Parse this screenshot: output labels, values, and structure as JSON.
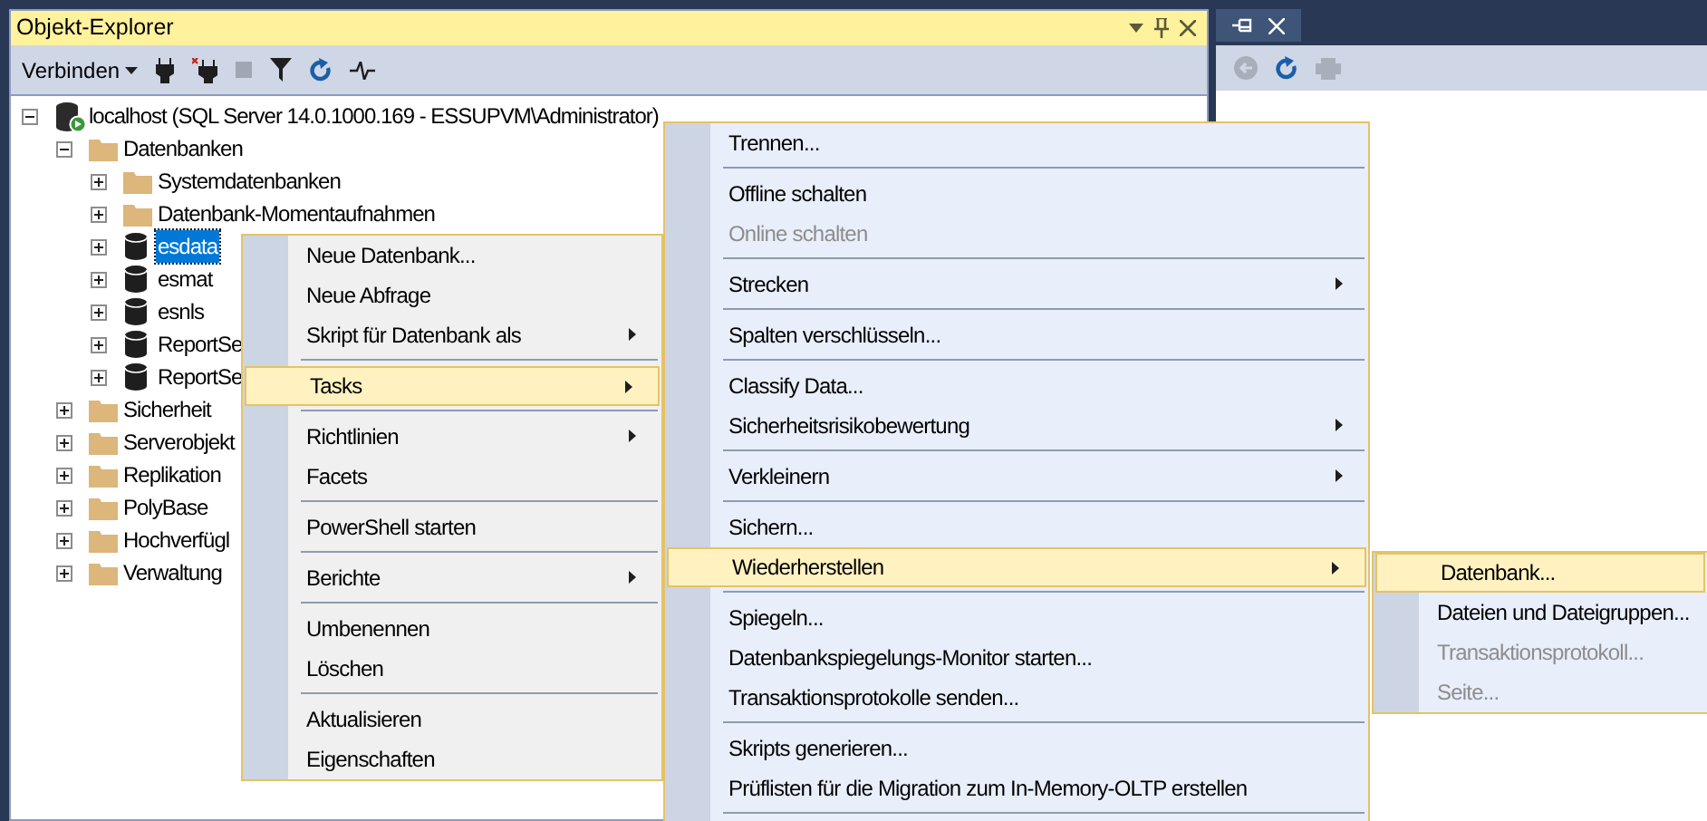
{
  "explorer": {
    "title": "Objekt-Explorer",
    "connect_label": "Verbinden",
    "tree": [
      {
        "kind": "server",
        "label": "localhost (SQL Server 14.0.1000.169 - ESSUPVM\\Administrator)",
        "expanded": true,
        "selected": false,
        "children": [
          {
            "kind": "folder",
            "label": "Datenbanken",
            "expanded": true,
            "selected": false,
            "children": [
              {
                "kind": "folder",
                "label": "Systemdatenbanken",
                "expanded": false,
                "selected": false
              },
              {
                "kind": "folder",
                "label": "Datenbank-Momentaufnahmen",
                "expanded": false,
                "selected": false
              },
              {
                "kind": "database",
                "label": "esdata",
                "expanded": false,
                "selected": true
              },
              {
                "kind": "database",
                "label": "esmat",
                "expanded": false,
                "selected": false
              },
              {
                "kind": "database",
                "label": "esnls",
                "expanded": false,
                "selected": false
              },
              {
                "kind": "database",
                "label": "ReportSe",
                "expanded": false,
                "selected": false
              },
              {
                "kind": "database",
                "label": "ReportSe",
                "expanded": false,
                "selected": false
              }
            ]
          },
          {
            "kind": "folder",
            "label": "Sicherheit",
            "expanded": false,
            "selected": false
          },
          {
            "kind": "folder",
            "label": "Serverobjekt",
            "expanded": false,
            "selected": false
          },
          {
            "kind": "folder",
            "label": "Replikation",
            "expanded": false,
            "selected": false
          },
          {
            "kind": "folder",
            "label": "PolyBase",
            "expanded": false,
            "selected": false
          },
          {
            "kind": "folder",
            "label": "Hochverfügl",
            "expanded": false,
            "selected": false
          },
          {
            "kind": "folder",
            "label": "Verwaltung",
            "expanded": false,
            "selected": false
          }
        ]
      }
    ]
  },
  "menus": [
    {
      "items": [
        {
          "kind": "item",
          "label": "Neue Datenbank...",
          "submenu": false,
          "disabled": false,
          "selected": false
        },
        {
          "kind": "item",
          "label": "Neue Abfrage",
          "submenu": false,
          "disabled": false,
          "selected": false
        },
        {
          "kind": "item",
          "label": "Skript für Datenbank als",
          "submenu": true,
          "disabled": false,
          "selected": false
        },
        {
          "kind": "separator"
        },
        {
          "kind": "item",
          "label": "Tasks",
          "submenu": true,
          "disabled": false,
          "selected": true
        },
        {
          "kind": "separator"
        },
        {
          "kind": "item",
          "label": "Richtlinien",
          "submenu": true,
          "disabled": false,
          "selected": false
        },
        {
          "kind": "item",
          "label": "Facets",
          "submenu": false,
          "disabled": false,
          "selected": false
        },
        {
          "kind": "separator"
        },
        {
          "kind": "item",
          "label": "PowerShell starten",
          "submenu": false,
          "disabled": false,
          "selected": false
        },
        {
          "kind": "separator"
        },
        {
          "kind": "item",
          "label": "Berichte",
          "submenu": true,
          "disabled": false,
          "selected": false
        },
        {
          "kind": "separator"
        },
        {
          "kind": "item",
          "label": "Umbenennen",
          "submenu": false,
          "disabled": false,
          "selected": false
        },
        {
          "kind": "item",
          "label": "Löschen",
          "submenu": false,
          "disabled": false,
          "selected": false
        },
        {
          "kind": "separator"
        },
        {
          "kind": "item",
          "label": "Aktualisieren",
          "submenu": false,
          "disabled": false,
          "selected": false
        },
        {
          "kind": "item",
          "label": "Eigenschaften",
          "submenu": false,
          "disabled": false,
          "selected": false
        }
      ]
    },
    {
      "items": [
        {
          "kind": "item",
          "label": "Trennen...",
          "submenu": false,
          "disabled": false,
          "selected": false
        },
        {
          "kind": "separator"
        },
        {
          "kind": "item",
          "label": "Offline schalten",
          "submenu": false,
          "disabled": false,
          "selected": false
        },
        {
          "kind": "item",
          "label": "Online schalten",
          "submenu": false,
          "disabled": true,
          "selected": false
        },
        {
          "kind": "separator"
        },
        {
          "kind": "item",
          "label": "Strecken",
          "submenu": true,
          "disabled": false,
          "selected": false
        },
        {
          "kind": "separator"
        },
        {
          "kind": "item",
          "label": "Spalten verschlüsseln...",
          "submenu": false,
          "disabled": false,
          "selected": false
        },
        {
          "kind": "separator"
        },
        {
          "kind": "item",
          "label": "Classify Data...",
          "submenu": false,
          "disabled": false,
          "selected": false
        },
        {
          "kind": "item",
          "label": "Sicherheitsrisikobewertung",
          "submenu": true,
          "disabled": false,
          "selected": false
        },
        {
          "kind": "separator"
        },
        {
          "kind": "item",
          "label": "Verkleinern",
          "submenu": true,
          "disabled": false,
          "selected": false
        },
        {
          "kind": "separator"
        },
        {
          "kind": "item",
          "label": "Sichern...",
          "submenu": false,
          "disabled": false,
          "selected": false
        },
        {
          "kind": "item",
          "label": "Wiederherstellen",
          "submenu": true,
          "disabled": false,
          "selected": true
        },
        {
          "kind": "separator"
        },
        {
          "kind": "item",
          "label": "Spiegeln...",
          "submenu": false,
          "disabled": false,
          "selected": false
        },
        {
          "kind": "item",
          "label": "Datenbankspiegelungs-Monitor starten...",
          "submenu": false,
          "disabled": false,
          "selected": false
        },
        {
          "kind": "item",
          "label": "Transaktionsprotokolle senden...",
          "submenu": false,
          "disabled": false,
          "selected": false
        },
        {
          "kind": "separator"
        },
        {
          "kind": "item",
          "label": "Skripts generieren...",
          "submenu": false,
          "disabled": false,
          "selected": false
        },
        {
          "kind": "item",
          "label": "Prüflisten für die Migration zum In-Memory-OLTP erstellen",
          "submenu": false,
          "disabled": false,
          "selected": false
        },
        {
          "kind": "separator"
        }
      ]
    },
    {
      "items": [
        {
          "kind": "item",
          "label": "Datenbank...",
          "submenu": false,
          "disabled": false,
          "selected": true
        },
        {
          "kind": "item",
          "label": "Dateien und Dateigruppen...",
          "submenu": false,
          "disabled": false,
          "selected": false
        },
        {
          "kind": "item",
          "label": "Transaktionsprotokoll...",
          "submenu": false,
          "disabled": true,
          "selected": false
        },
        {
          "kind": "item",
          "label": "Seite...",
          "submenu": false,
          "disabled": true,
          "selected": false
        }
      ]
    }
  ]
}
